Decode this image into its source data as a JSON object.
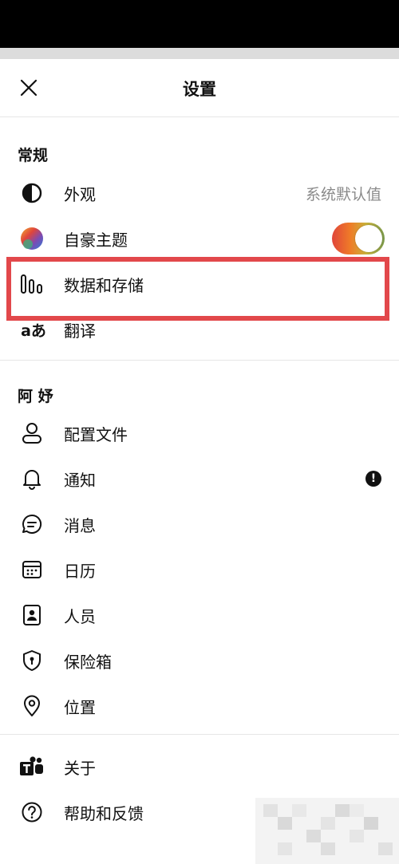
{
  "header": {
    "title": "设置"
  },
  "sections": {
    "general": {
      "title": "常规",
      "appearance": {
        "label": "外观",
        "value": "系统默认值",
        "icon": "half-circle-icon"
      },
      "pride_theme": {
        "label": "自豪主题",
        "icon": "color-wheel-icon",
        "toggle_on": true
      },
      "data_storage": {
        "label": "数据和存储",
        "icon": "bars-chart-icon"
      },
      "translate": {
        "label": "翻译",
        "icon": "translate-icon",
        "icon_text": "aあ"
      }
    },
    "account": {
      "title": "阿 妤",
      "profile": {
        "label": "配置文件",
        "icon": "person-icon"
      },
      "notifications": {
        "label": "通知",
        "icon": "bell-icon",
        "badge": "!"
      },
      "messages": {
        "label": "消息",
        "icon": "chat-icon"
      },
      "calendar": {
        "label": "日历",
        "icon": "calendar-icon"
      },
      "people": {
        "label": "人员",
        "icon": "contact-book-icon"
      },
      "vault": {
        "label": "保险箱",
        "icon": "shield-keyhole-icon"
      },
      "location": {
        "label": "位置",
        "icon": "location-pin-icon"
      }
    },
    "other": {
      "about": {
        "label": "关于",
        "icon": "teams-logo-icon"
      },
      "help": {
        "label": "帮助和反馈",
        "icon": "question-circle-icon"
      }
    }
  },
  "colors": {
    "highlight": "#e2484b",
    "toggle_gradient_start": "#e0453a",
    "toggle_gradient_end": "#7a9a4c",
    "secondary_text": "#8a8a8a"
  }
}
